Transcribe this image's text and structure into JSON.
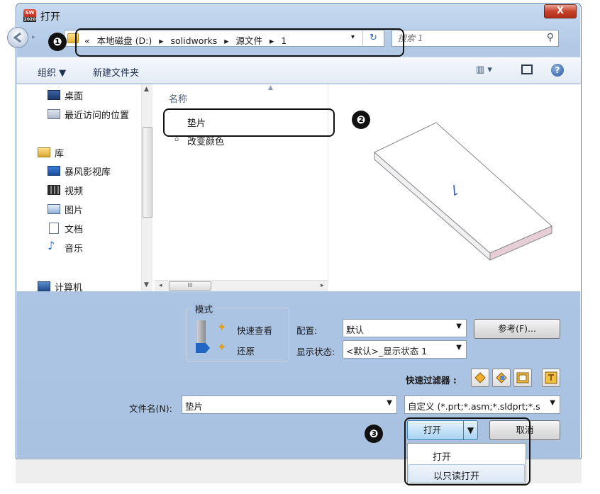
{
  "window": {
    "title": "打开",
    "app_icon_text": "SW",
    "app_icon_year": "2020",
    "close_glyph": "X"
  },
  "address": {
    "crumbs": [
      "«",
      "本地磁盘 (D:)",
      "▸",
      "solidworks",
      "▸",
      "源文件",
      "▸",
      "1"
    ],
    "dropdown_glyph": "▾",
    "refresh_glyph": "↻"
  },
  "search": {
    "placeholder": "搜索 1"
  },
  "toolbar": {
    "organize": "组织 ▼",
    "new_folder": "新建文件夹",
    "view_glyph": "▥ ▾"
  },
  "nav": {
    "items": [
      {
        "label": "桌面",
        "icon": "desktop-icon"
      },
      {
        "label": "最近访问的位置",
        "icon": "recent-icon"
      },
      {
        "label": "库",
        "icon": "library-icon"
      },
      {
        "label": "暴风影视库",
        "icon": "video-library-icon"
      },
      {
        "label": "视频",
        "icon": "video-icon"
      },
      {
        "label": "图片",
        "icon": "picture-icon"
      },
      {
        "label": "文档",
        "icon": "document-icon"
      },
      {
        "label": "音乐",
        "icon": "music-icon"
      },
      {
        "label": "计算机",
        "icon": "computer-icon"
      }
    ]
  },
  "files": {
    "column_header": "名称",
    "rows": [
      {
        "name": "垫片"
      },
      {
        "name": "改变颜色"
      }
    ],
    "hscroll_thumb_glyph": "III"
  },
  "mode": {
    "legend": "模式",
    "quick_view": "快速查看",
    "restore": "还原"
  },
  "config": {
    "config_label": "配置:",
    "config_value": "默认",
    "display_state_label": "显示状态:",
    "display_state_value": "<默认>_显示状态 1",
    "reference_button": "参考(F)..."
  },
  "filters": {
    "label": "快速过滤器 :"
  },
  "filename": {
    "label": "文件名(N):",
    "value": "垫片",
    "filetype": "自定义 (*.prt;*.asm;*.sldprt;*.s"
  },
  "buttons": {
    "open": "打开",
    "cancel": "取消"
  },
  "open_menu": {
    "items": [
      "打开",
      "以只读打开"
    ]
  },
  "callouts": [
    "❶",
    "❷",
    "❸"
  ],
  "colors": {
    "frame": "#a9c2e2",
    "accent": "#2d6cc2",
    "callout": "#111111"
  }
}
